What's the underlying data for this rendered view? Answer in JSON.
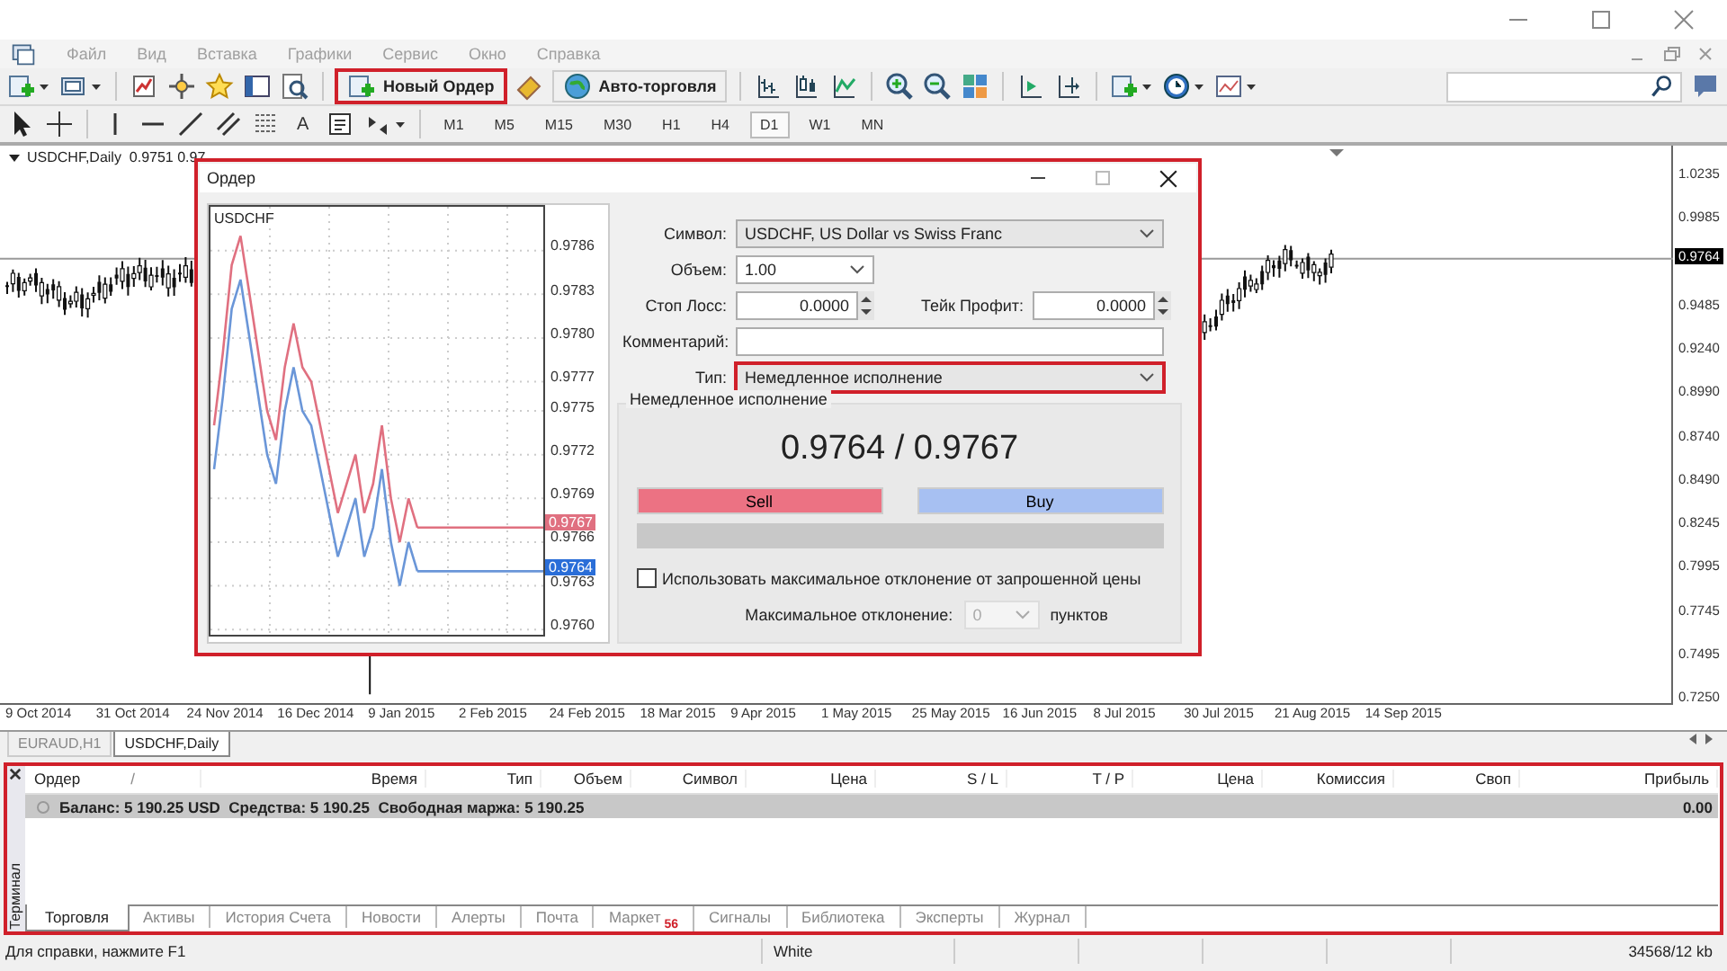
{
  "menu": [
    "Файл",
    "Вид",
    "Вставка",
    "Графики",
    "Сервис",
    "Окно",
    "Справка"
  ],
  "toolbar": {
    "new_order": {
      "label": "Новый Ордер",
      "highlighted": true
    },
    "auto_trading": {
      "label": "Авто-торговля"
    }
  },
  "drawing_tools": {
    "text_tool": "A"
  },
  "timeframes": [
    {
      "label": "M1",
      "selected": false
    },
    {
      "label": "M5",
      "selected": false
    },
    {
      "label": "M15",
      "selected": false
    },
    {
      "label": "M30",
      "selected": false
    },
    {
      "label": "H1",
      "selected": false
    },
    {
      "label": "H4",
      "selected": false
    },
    {
      "label": "D1",
      "selected": true
    },
    {
      "label": "W1",
      "selected": false
    },
    {
      "label": "MN",
      "selected": false
    }
  ],
  "chart": {
    "header": "USDCHF,Daily  0.9751 0.97",
    "price_scale": [
      "1.0235",
      "0.9985",
      "0.9485",
      "0.9240",
      "0.8990",
      "0.8740",
      "0.8490",
      "0.8245",
      "0.7995",
      "0.7745",
      "0.7495",
      "0.7250"
    ],
    "current_price": "0.9764",
    "date_scale": [
      "9 Oct 2014",
      "31 Oct 2014",
      "24 Nov 2014",
      "16 Dec 2014",
      "9 Jan 2015",
      "2 Feb 2015",
      "24 Feb 2015",
      "18 Mar 2015",
      "9 Apr 2015",
      "1 May 2015",
      "25 May 2015",
      "16 Jun 2015",
      "8 Jul 2015",
      "30 Jul 2015",
      "21 Aug 2015",
      "14 Sep 2015"
    ]
  },
  "chart_tabs": [
    {
      "label": "EURAUD,H1",
      "selected": false
    },
    {
      "label": "USDCHF,Daily",
      "selected": true
    }
  ],
  "order_dialog": {
    "title": "Ордер",
    "highlighted": true,
    "mini_chart": {
      "symbol": "USDCHF",
      "ask_marker": "0.9767",
      "bid_marker": "0.9764",
      "chart_data": {
        "type": "line",
        "grid": true,
        "ylim": [
          0.97594,
          0.9789
        ],
        "yticks": [
          {
            "value": 0.9786,
            "label": "0.9786"
          },
          {
            "value": 0.9783,
            "label": "0.9783"
          },
          {
            "value": 0.978,
            "label": "0.9780"
          },
          {
            "value": 0.9777,
            "label": "0.9777"
          },
          {
            "value": 0.9775,
            "label": "0.9775"
          },
          {
            "value": 0.9772,
            "label": "0.9772"
          },
          {
            "value": 0.9769,
            "label": "0.9769"
          },
          {
            "value": 0.9766,
            "label": "0.9766"
          },
          {
            "value": 0.9763,
            "label": "0.9763"
          },
          {
            "value": 0.976,
            "label": "0.9760"
          }
        ],
        "series": [
          {
            "color": "#e07080",
            "values": [
              0.9774,
              0.9779,
              0.9785,
              0.9787,
              0.9783,
              0.9779,
              0.9775,
              0.9773,
              0.9778,
              0.9781,
              0.9778,
              0.9777,
              0.9774,
              0.9771,
              0.9768,
              0.977,
              0.9772,
              0.9768,
              0.977,
              0.9774,
              0.9769,
              0.9766,
              0.9769,
              0.9767
            ]
          },
          {
            "color": "#6a96d8",
            "values": [
              0.9771,
              0.9776,
              0.9782,
              0.9784,
              0.978,
              0.9776,
              0.9772,
              0.977,
              0.9775,
              0.9778,
              0.9775,
              0.9774,
              0.9771,
              0.9768,
              0.9765,
              0.9767,
              0.9769,
              0.9765,
              0.9767,
              0.9771,
              0.9766,
              0.9763,
              0.9766,
              0.9764
            ]
          }
        ]
      }
    },
    "symbol": {
      "label": "Символ:",
      "value": "USDCHF, US Dollar vs Swiss Franc"
    },
    "volume": {
      "label": "Объем:",
      "value": "1.00"
    },
    "stop_loss": {
      "label": "Стоп Лосс:",
      "value": "0.0000"
    },
    "take_profit": {
      "label": "Тейк Профит:",
      "value": "0.0000"
    },
    "comment": {
      "label": "Комментарий:"
    },
    "type": {
      "label": "Тип:",
      "value": "Немедленное исполнение",
      "highlighted": true
    },
    "execution": {
      "title": "Немедленное исполнение",
      "quote": "0.9764 / 0.9767",
      "sell": "Sell",
      "buy": "Buy"
    },
    "max_deviation": {
      "checkbox_label": "Использовать максимальное отклонение от запрошенной цены",
      "checked": false,
      "label": "Максимальное отклонение:",
      "value": "0",
      "unit": "пунктов",
      "disabled": true
    }
  },
  "terminal": {
    "highlighted": true,
    "side_label": "Терминал",
    "sort_mark": "/",
    "columns": [
      "Ордер",
      "Время",
      "Тип",
      "Объем",
      "Символ",
      "Цена",
      "S / L",
      "T / P",
      "Цена",
      "Комиссия",
      "Своп",
      "Прибыль"
    ],
    "balance_row": {
      "text": "Баланс: 5 190.25 USD  Средства: 5 190.25  Свободная маржа: 5 190.25",
      "profit": "0.00"
    },
    "tabs": [
      {
        "label": "Торговля",
        "selected": true
      },
      {
        "label": "Активы",
        "selected": false
      },
      {
        "label": "История Счета",
        "selected": false
      },
      {
        "label": "Новости",
        "selected": false
      },
      {
        "label": "Алерты",
        "selected": false
      },
      {
        "label": "Почта",
        "selected": false
      },
      {
        "label": "Маркет",
        "selected": false,
        "badge": "56"
      },
      {
        "label": "Сигналы",
        "selected": false
      },
      {
        "label": "Библиотека",
        "selected": false
      },
      {
        "label": "Эксперты",
        "selected": false
      },
      {
        "label": "Журнал",
        "selected": false
      }
    ]
  },
  "status_bar": {
    "help": "Для справки, нажмите F1",
    "profile": "White",
    "traffic": "34568/12 kb"
  }
}
